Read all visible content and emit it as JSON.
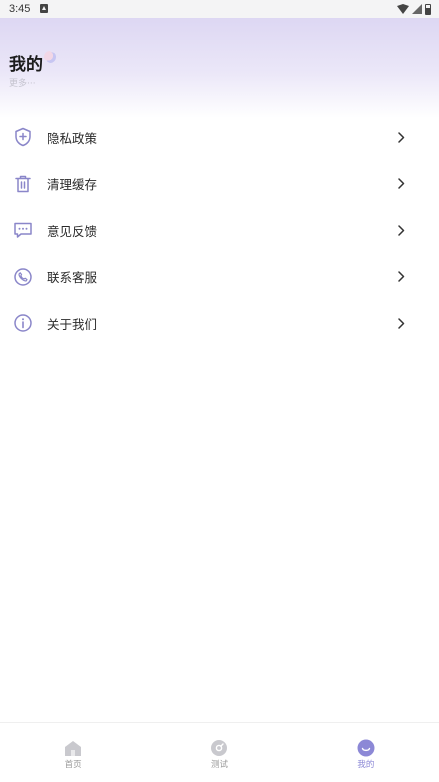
{
  "status_bar": {
    "time": "3:45"
  },
  "header": {
    "title": "我的",
    "subtitle": "更多···"
  },
  "menu": {
    "items": [
      {
        "label": "隐私政策",
        "icon": "shield-plus-icon"
      },
      {
        "label": "清理缓存",
        "icon": "trash-icon"
      },
      {
        "label": "意见反馈",
        "icon": "chat-bubble-icon"
      },
      {
        "label": "联系客服",
        "icon": "phone-icon"
      },
      {
        "label": "关于我们",
        "icon": "info-icon"
      }
    ]
  },
  "tabbar": {
    "tabs": [
      {
        "label": "首页",
        "icon": "home-icon",
        "active": false
      },
      {
        "label": "测试",
        "icon": "test-icon",
        "active": false
      },
      {
        "label": "我的",
        "icon": "profile-smile-icon",
        "active": true
      }
    ]
  },
  "colors": {
    "accent": "#8c88d6",
    "icon": "#8a86c9",
    "header_gradient_top": "#ddd7f3"
  }
}
